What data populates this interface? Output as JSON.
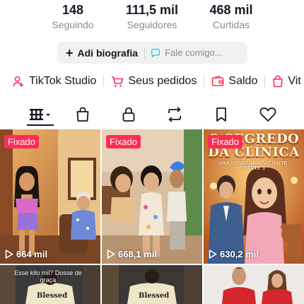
{
  "stats": [
    {
      "value": "148",
      "label": "Seguindo"
    },
    {
      "value": "111,5 mil",
      "label": "Seguidores"
    },
    {
      "value": "468 mil",
      "label": "Curtidas"
    }
  ],
  "bio": {
    "add_label": "Adicionar biografia",
    "add_label_short": "Adicionar biografia",
    "add_text": "Adicionar",
    "placeholder": "Fale comigo..."
  },
  "links": [
    {
      "label": "TikTok Studio",
      "icon": "person-plus-icon"
    },
    {
      "label": "Seus pedidos",
      "icon": "cart-icon"
    },
    {
      "label": "Saldo",
      "icon": "wallet-icon"
    },
    {
      "label": "Vit",
      "icon": "bag-icon"
    }
  ],
  "tabs": [
    {
      "icon": "grid-icon",
      "active": true
    },
    {
      "icon": "shopping-bag-icon"
    },
    {
      "icon": "lock-icon"
    },
    {
      "icon": "repost-icon"
    },
    {
      "icon": "bookmark-icon"
    },
    {
      "icon": "heart-icon"
    }
  ],
  "videos": [
    {
      "badge": "Fixado",
      "views": "664 mil"
    },
    {
      "badge": "Fixado",
      "views": "668,1 mil"
    },
    {
      "badge": "Fixado",
      "views": "630,2 mil",
      "title": "O SEGREDO DA CLÍNICA",
      "subtitle": "UMA NOVELINHA VICIANTE - PARTE 1"
    },
    {
      "caption": "Esse kilo mil? Dosse de graça",
      "shirt": "Blessed"
    },
    {
      "shirt": "Blessed"
    },
    {}
  ],
  "colors": {
    "accent": "#fe2c55",
    "text": "#161823",
    "muted": "#8a8b91",
    "chat": "#20d5ec"
  }
}
